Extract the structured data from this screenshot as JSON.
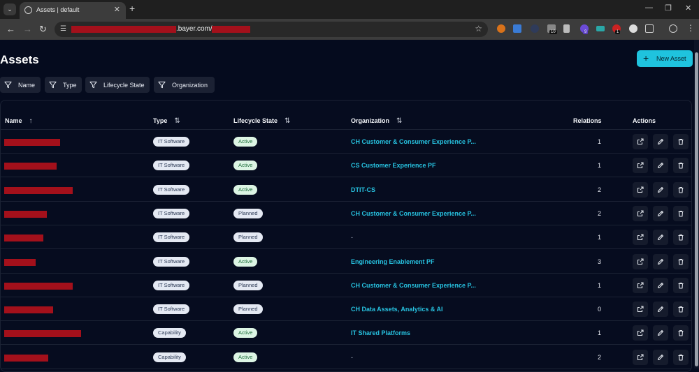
{
  "browser": {
    "tab_title": "Assets | default",
    "url_domain": ".bayer.com/",
    "ext_badges": [
      "10",
      "9",
      "1"
    ]
  },
  "page": {
    "title": "Assets",
    "new_button_label": "New Asset"
  },
  "filters": [
    "Name",
    "Type",
    "Lifecycle State",
    "Organization"
  ],
  "table": {
    "columns": [
      "Name",
      "Type",
      "Lifecycle State",
      "Organization",
      "Relations",
      "Actions"
    ],
    "rows": [
      {
        "type": "IT Software",
        "state": "Active",
        "org": "CH Customer & Consumer Experience P...",
        "relations": "1"
      },
      {
        "type": "IT Software",
        "state": "Active",
        "org": "CS Customer Experience PF",
        "relations": "1"
      },
      {
        "type": "IT Software",
        "state": "Active",
        "org": "DTIT-CS",
        "relations": "2"
      },
      {
        "type": "IT Software",
        "state": "Planned",
        "org": "CH Customer & Consumer Experience P...",
        "relations": "2"
      },
      {
        "type": "IT Software",
        "state": "Planned",
        "org": "-",
        "relations": "1"
      },
      {
        "type": "IT Software",
        "state": "Active",
        "org": "Engineering Enablement PF",
        "relations": "3"
      },
      {
        "type": "IT Software",
        "state": "Planned",
        "org": "CH Customer & Consumer Experience P...",
        "relations": "1"
      },
      {
        "type": "IT Software",
        "state": "Planned",
        "org": "CH Data Assets, Analytics & AI",
        "relations": "0"
      },
      {
        "type": "Capability",
        "state": "Active",
        "org": "IT Shared Platforms",
        "relations": "1"
      },
      {
        "type": "Capability",
        "state": "Active",
        "org": "-",
        "relations": "2"
      }
    ]
  },
  "colors": {
    "accent": "#1fc3de",
    "background": "#050b1e",
    "redaction": "#a3101b"
  }
}
